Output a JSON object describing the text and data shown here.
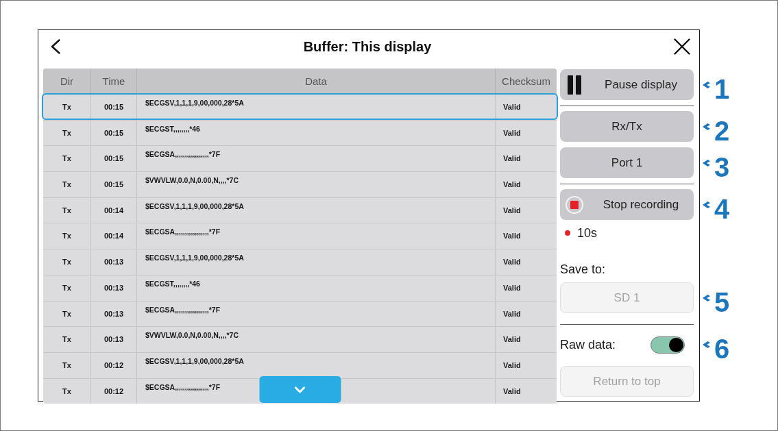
{
  "dialog": {
    "title": "Buffer: This display"
  },
  "table": {
    "columns": [
      "Dir",
      "Time",
      "Data",
      "Checksum"
    ],
    "rows": [
      {
        "dir": "Tx",
        "time": "00:15",
        "data": "$ECGSV,1,1,1,9,00,000,28*5A",
        "checksum": "Valid",
        "selected": true
      },
      {
        "dir": "Tx",
        "time": "00:15",
        "data": "$ECGST,,,,,,,,*46",
        "checksum": "Valid",
        "selected": false
      },
      {
        "dir": "Tx",
        "time": "00:15",
        "data": "$ECGSA,,,,,,,,,,,,,,,,,*7F",
        "checksum": "Valid",
        "selected": false
      },
      {
        "dir": "Tx",
        "time": "00:15",
        "data": "$VWVLW,0.0,N,0.00,N,,,,*7C",
        "checksum": "Valid",
        "selected": false
      },
      {
        "dir": "Tx",
        "time": "00:14",
        "data": "$ECGSV,1,1,1,9,00,000,28*5A",
        "checksum": "Valid",
        "selected": false
      },
      {
        "dir": "Tx",
        "time": "00:14",
        "data": "$ECGSA,,,,,,,,,,,,,,,,,*7F",
        "checksum": "Valid",
        "selected": false
      },
      {
        "dir": "Tx",
        "time": "00:13",
        "data": "$ECGSV,1,1,1,9,00,000,28*5A",
        "checksum": "Valid",
        "selected": false
      },
      {
        "dir": "Tx",
        "time": "00:13",
        "data": "$ECGST,,,,,,,,*46",
        "checksum": "Valid",
        "selected": false
      },
      {
        "dir": "Tx",
        "time": "00:13",
        "data": "$ECGSA,,,,,,,,,,,,,,,,,*7F",
        "checksum": "Valid",
        "selected": false
      },
      {
        "dir": "Tx",
        "time": "00:13",
        "data": "$VWVLW,0.0,N,0.00,N,,,,*7C",
        "checksum": "Valid",
        "selected": false
      },
      {
        "dir": "Tx",
        "time": "00:12",
        "data": "$ECGSV,1,1,1,9,00,000,28*5A",
        "checksum": "Valid",
        "selected": false
      },
      {
        "dir": "Tx",
        "time": "00:12",
        "data": "$ECGSA,,,,,,,,,,,,,,,,,*7F",
        "checksum": "Valid",
        "selected": false
      }
    ]
  },
  "panel": {
    "items": [
      {
        "kind": "pause",
        "label": "Pause display",
        "callout": "1"
      },
      {
        "kind": "divider"
      },
      {
        "kind": "button",
        "label": "Rx/Tx",
        "disabled": false,
        "callout": "2"
      },
      {
        "kind": "button",
        "label": "Port 1",
        "disabled": false,
        "callout": "3"
      },
      {
        "kind": "divider"
      },
      {
        "kind": "record",
        "label": "Stop recording",
        "callout": "4"
      },
      {
        "kind": "status",
        "text": "10s"
      },
      {
        "kind": "label",
        "text": "Save to:"
      },
      {
        "kind": "button",
        "label": "SD 1",
        "disabled": true,
        "callout": "5"
      },
      {
        "kind": "divider"
      },
      {
        "kind": "toggle",
        "label": "Raw data:",
        "on": true,
        "callout": "6"
      },
      {
        "kind": "button",
        "label": "Return to top",
        "disabled": true
      }
    ]
  }
}
